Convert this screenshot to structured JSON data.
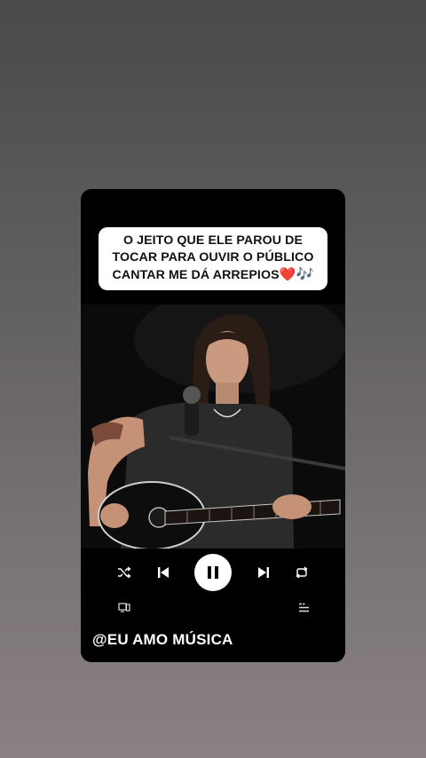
{
  "caption": {
    "line1": "O JEITO QUE ELE PAROU DE",
    "line2": "TOCAR PARA OUVIR O PÚBLICO",
    "line3": "CANTAR ME DÁ ARREPIOS",
    "emoji_heart": "❤️",
    "emoji_notes": "🎶"
  },
  "video": {
    "icon": "video-frame-guitarist"
  },
  "player_controls": {
    "shuffle_icon": "shuffle-icon",
    "previous_icon": "skip-previous-icon",
    "play_pause_icon": "pause-icon",
    "next_icon": "skip-next-icon",
    "repeat_icon": "repeat-icon",
    "devices_icon": "connect-devices-icon",
    "queue_icon": "queue-icon",
    "accent_color": "#ffffff"
  },
  "watermark": "@EU AMO MÚSICA"
}
